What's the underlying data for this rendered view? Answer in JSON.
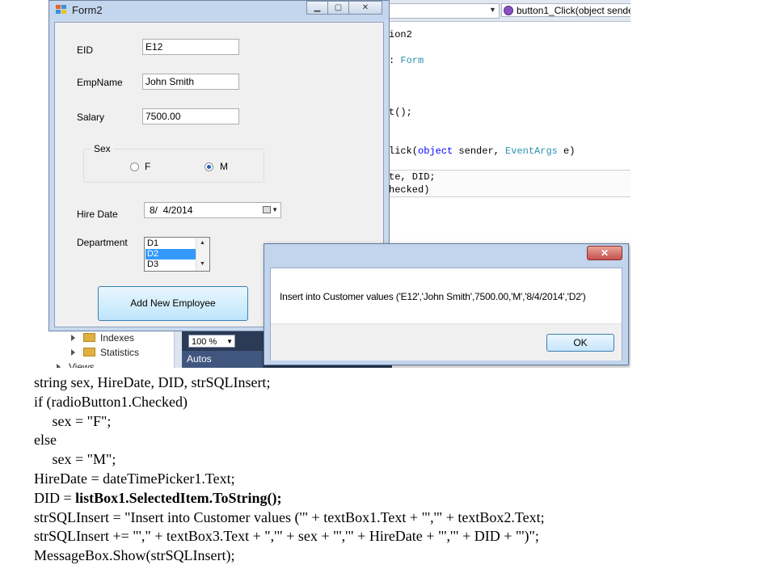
{
  "editor": {
    "method_dropdown": "button1_Click(object sende",
    "code_lines": [
      {
        "text": "ion2"
      },
      {
        "text": ": Form"
      },
      {
        "text": "t();"
      },
      {
        "text": "lick(object sender, EventArgs e)"
      },
      {
        "text": "te, DID;"
      },
      {
        "text": "hecked)"
      }
    ]
  },
  "solution_explorer": {
    "items": [
      "Indexes",
      "Statistics",
      "Views"
    ]
  },
  "bottom_panel": {
    "zoom": "100 %",
    "autos_tab": "Autos"
  },
  "form2": {
    "title": "Form2",
    "eid_label": "EID",
    "eid_value": "E12",
    "empname_label": "EmpName",
    "empname_value": "John Smith",
    "salary_label": "Salary",
    "salary_value": "7500.00",
    "sex_group_label": "Sex",
    "radio_f_label": "F",
    "radio_m_label": "M",
    "radio_selected": "M",
    "hiredate_label": "Hire Date",
    "hiredate_value": "8/  4/2014",
    "department_label": "Department",
    "department_items": [
      "D1",
      "D2",
      "D3"
    ],
    "department_selected": "D2",
    "add_button_label": "Add New Employee"
  },
  "messagebox": {
    "close_glyph": "✕",
    "message": "Insert into Customer values ('E12','John Smith',7500.00,'M','8/4/2014','D2')",
    "ok_label": "OK"
  },
  "code_listing": [
    "string sex, HireDate, DID, strSQLInsert;",
    "if (radioButton1.Checked)",
    "     sex = \"F\";",
    "else",
    "     sex = \"M\";",
    "HireDate = dateTimePicker1.Text;",
    "DID = ",
    "listBox1.SelectedItem.ToString();",
    "strSQLInsert = \"Insert into Customer values ('\" + textBox1.Text + \"','\" + textBox2.Text;",
    "strSQLInsert += \"',\" + textBox3.Text + \",'\" + sex + \"','\" + HireDate + \"','\" + DID + \"')\";",
    "MessageBox.Show(strSQLInsert);"
  ],
  "colors": {
    "keyword": "#0000ff",
    "type_name": "#2b91af",
    "selection": "#3399ff"
  }
}
